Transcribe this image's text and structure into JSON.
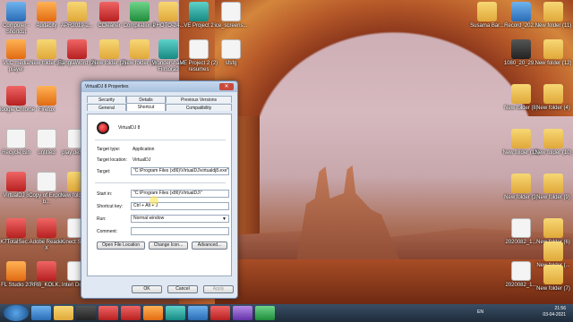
{
  "desktop": {
    "icons_left": [
      {
        "label": "Computer - Shortcut",
        "icon": "computer-icon",
        "color": "g-blue"
      },
      {
        "label": "Audacity",
        "icon": "audacity-icon",
        "color": "g-orange"
      },
      {
        "label": "APR2019-2...",
        "icon": "folder-icon",
        "color": "g-folder"
      },
      {
        "label": "CCleaner",
        "icon": "ccleaner-icon",
        "color": "g-red"
      },
      {
        "label": "Compilation 1",
        "icon": "excel-icon",
        "color": "g-green"
      },
      {
        "label": "PHOTO-24...",
        "icon": "folder-icon",
        "color": "g-folder"
      },
      {
        "label": "VE Project 2",
        "icon": "filmora-icon",
        "color": "g-teal"
      },
      {
        "label": "ice_screens...",
        "icon": "file-icon",
        "color": "g-white"
      },
      {
        "label": "VLC media player",
        "icon": "vlc-icon",
        "color": "g-orange"
      },
      {
        "label": "New folder (7)",
        "icon": "folder-icon",
        "color": "g-folder"
      },
      {
        "label": "BanglaWord (2)",
        "icon": "word-icon",
        "color": "g-red"
      },
      {
        "label": "New folder (2)",
        "icon": "folder-icon",
        "color": "g-folder"
      },
      {
        "label": "New folder (5)",
        "icon": "folder-icon",
        "color": "g-folder"
      },
      {
        "label": "Wondershare Filmora9",
        "icon": "filmora-icon",
        "color": "g-teal"
      },
      {
        "label": "VE Project 2 (2) resumes",
        "icon": "file-icon",
        "color": "g-white"
      },
      {
        "label": "sfsfg",
        "icon": "file-icon",
        "color": "g-white"
      },
      {
        "label": "Google Chrome",
        "icon": "chrome-icon",
        "color": "g-red"
      },
      {
        "label": "Firefox",
        "icon": "firefox-icon",
        "color": "g-orange"
      },
      {
        "label": "Recycle Bin",
        "icon": "recycle-bin-icon",
        "color": "g-white"
      },
      {
        "label": "untitled",
        "icon": "file-icon",
        "color": "g-white"
      },
      {
        "label": "play descri...",
        "icon": "file-icon",
        "color": "g-white"
      },
      {
        "label": "VirtualDJ 8",
        "icon": "virtualdj-icon",
        "color": "g-red"
      },
      {
        "label": "Copy of Export b...",
        "icon": "file-icon",
        "color": "g-white"
      },
      {
        "label": "New folder (...",
        "icon": "folder-icon",
        "color": "g-folder"
      },
      {
        "label": "K7TotalSec...",
        "icon": "k7-icon",
        "color": "g-red"
      },
      {
        "label": "Adobe Reader X",
        "icon": "adobe-icon",
        "color": "g-red"
      },
      {
        "label": "Kinect Scre...",
        "icon": "file-icon",
        "color": "g-white"
      },
      {
        "label": "FL Studio 20",
        "icon": "flstudio-icon",
        "color": "g-orange"
      },
      {
        "label": "RRB_KOLK...",
        "icon": "pdf-icon",
        "color": "g-red"
      },
      {
        "label": "Interi Docu...",
        "icon": "file-icon",
        "color": "g-white"
      }
    ],
    "icons_right": [
      {
        "label": "Susama Bar...",
        "icon": "folder-icon",
        "color": "g-folder"
      },
      {
        "label": "Record_202...",
        "icon": "file-icon",
        "color": "g-blue"
      },
      {
        "label": "New folder (11)",
        "icon": "folder-icon",
        "color": "g-folder"
      },
      {
        "label": "1080_20_29...",
        "icon": "file-icon",
        "color": "g-dark"
      },
      {
        "label": "New folder (12)",
        "icon": "folder-icon",
        "color": "g-folder"
      },
      {
        "label": "New folder (8)",
        "icon": "folder-icon",
        "color": "g-folder"
      },
      {
        "label": "New folder (4)",
        "icon": "folder-icon",
        "color": "g-folder"
      },
      {
        "label": "New folder (13)",
        "icon": "folder-icon",
        "color": "g-folder"
      },
      {
        "label": "New folder (10)",
        "icon": "folder-icon",
        "color": "g-folder"
      },
      {
        "label": "New folder (3)",
        "icon": "folder-icon",
        "color": "g-folder"
      },
      {
        "label": "New folder (9)",
        "icon": "folder-icon",
        "color": "g-folder"
      },
      {
        "label": "New folder (6)",
        "icon": "folder-icon",
        "color": "g-folder"
      },
      {
        "label": "2020082_1...",
        "icon": "file-icon",
        "color": "g-white"
      },
      {
        "label": "New folder (...",
        "icon": "folder-icon",
        "color": "g-folder"
      },
      {
        "label": "2020082_1...",
        "icon": "file-icon",
        "color": "g-white"
      },
      {
        "label": "New folder (7)",
        "icon": "folder-icon",
        "color": "g-folder"
      }
    ]
  },
  "dialog": {
    "title": "VirtualDJ 8 Properties",
    "close_glyph": "✕",
    "tabs": [
      "Security",
      "Details",
      "Previous Versions",
      "General",
      "Shortcut",
      "Compatibility"
    ],
    "app_name": "VirtualDJ 8",
    "target_type_label": "Target type:",
    "target_type_value": "Application",
    "target_location_label": "Target location:",
    "target_location_value": "VirtualDJ",
    "target_label": "Target:",
    "target_value": "\"C:\\Program Files (x86)\\VirtualDJ\\virtualdj8.exe\"",
    "start_in_label": "Start in:",
    "start_in_value": "\"C:\\Program Files (x86)\\VirtualDJ\\\"",
    "shortcut_key_label": "Shortcut key:",
    "shortcut_key_value": "Ctrl + Alt + J",
    "run_label": "Run:",
    "run_value": "Normal window",
    "comment_label": "Comment:",
    "comment_value": "",
    "btn_open_location": "Open File Location",
    "btn_change_icon": "Change Icon...",
    "btn_advanced": "Advanced...",
    "btn_ok": "OK",
    "btn_cancel": "Cancel",
    "btn_apply": "Apply"
  },
  "taskbar": {
    "lang": "EN",
    "time": "21:56",
    "date": "03-04-2021"
  }
}
